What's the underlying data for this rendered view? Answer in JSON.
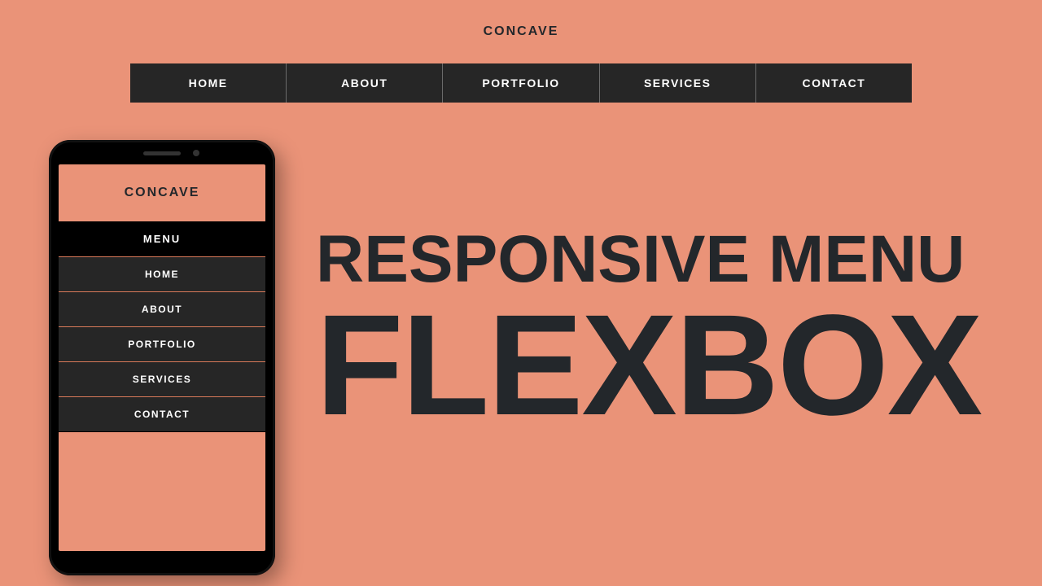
{
  "brand": "CONCAVE",
  "desktop_nav": {
    "items": [
      {
        "label": "HOME"
      },
      {
        "label": "ABOUT"
      },
      {
        "label": "PORTFOLIO"
      },
      {
        "label": "SERVICES"
      },
      {
        "label": "CONTACT"
      }
    ]
  },
  "mobile": {
    "menu_header": "MENU",
    "items": [
      {
        "label": "HOME"
      },
      {
        "label": "ABOUT"
      },
      {
        "label": "PORTFOLIO"
      },
      {
        "label": "SERVICES"
      },
      {
        "label": "CONTACT"
      }
    ]
  },
  "headline": {
    "line1": "RESPONSIVE MENU",
    "line2": "FLEXBOX"
  },
  "colors": {
    "background": "#ea9378",
    "nav_bg": "#262626",
    "text_dark": "#23272b",
    "divider_accent": "#d97a5a"
  }
}
